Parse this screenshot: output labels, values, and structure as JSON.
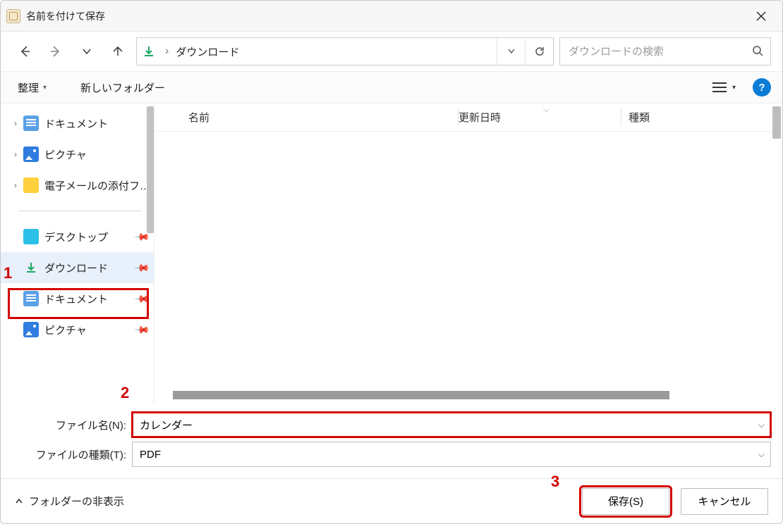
{
  "title": "名前を付けて保存",
  "nav": {
    "breadcrumb": "ダウンロード"
  },
  "search": {
    "placeholder": "ダウンロードの検索"
  },
  "toolbar": {
    "organize": "整理",
    "newfolder": "新しいフォルダー"
  },
  "columns": {
    "name": "名前",
    "date": "更新日時",
    "type": "種類"
  },
  "tree": {
    "doc1": "ドキュメント",
    "pic1": "ピクチャ",
    "mail": "電子メールの添付ファイル",
    "desktop": "デスクトップ",
    "downloads": "ダウンロード",
    "doc2": "ドキュメント",
    "pic2": "ピクチャ"
  },
  "fields": {
    "filename_label": "ファイル名(N):",
    "filename_value": "カレンダー",
    "filetype_label": "ファイルの種類(T):",
    "filetype_value": "PDF"
  },
  "footer": {
    "hide_folders": "フォルダーの非表示",
    "save": "保存(S)",
    "cancel": "キャンセル"
  },
  "annotations": {
    "a1": "1",
    "a2": "2",
    "a3": "3"
  }
}
